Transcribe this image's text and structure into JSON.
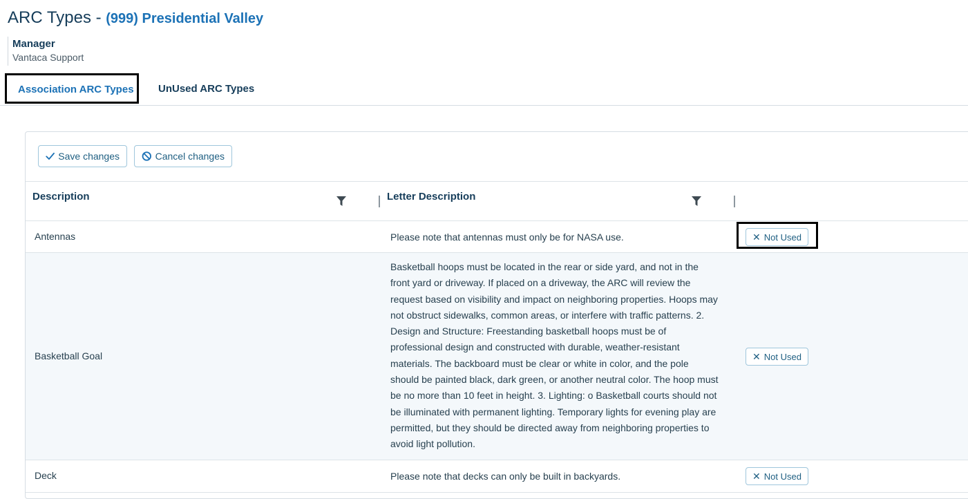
{
  "header": {
    "title": "ARC Types - ",
    "association": "(999) Presidential Valley",
    "manager_label": "Manager",
    "manager_value": "Vantaca Support"
  },
  "tabs": [
    {
      "label": "Association ARC Types",
      "active": true
    },
    {
      "label": "UnUsed ARC Types",
      "active": false
    }
  ],
  "toolbar": {
    "save_label": "Save changes",
    "cancel_label": "Cancel changes"
  },
  "grid": {
    "columns": [
      "Description",
      "Letter Description"
    ],
    "rows": [
      {
        "description": "Antennas",
        "letter": "Please note that antennas must only be for NASA use.",
        "action": "Not Used"
      },
      {
        "description": "Basketball Goal",
        "letter": "Basketball hoops must be located in the rear or side yard, and not in the front yard or driveway. If placed on a driveway, the ARC will review the request based on visibility and impact on neighboring properties. Hoops may not obstruct sidewalks, common areas, or interfere with traffic patterns. 2. Design and Structure: Freestanding basketball hoops must be of professional design and constructed with durable, weather-resistant materials. The backboard must be clear or white in color, and the pole should be painted black, dark green, or another neutral color. The hoop must be no more than 10 feet in height. 3. Lighting: o Basketball courts should not be illuminated with permanent lighting. Temporary lights for evening play are permitted, but they should be directed away from neighboring properties to avoid light pollution.",
        "action": "Not Used"
      },
      {
        "description": "Deck",
        "letter": "Please note that decks can only be built in backyards.",
        "action": "Not Used"
      }
    ]
  },
  "colors": {
    "accent": "#1c72b6",
    "heading": "#163d5a",
    "row_alt": "#f4f8fb"
  }
}
